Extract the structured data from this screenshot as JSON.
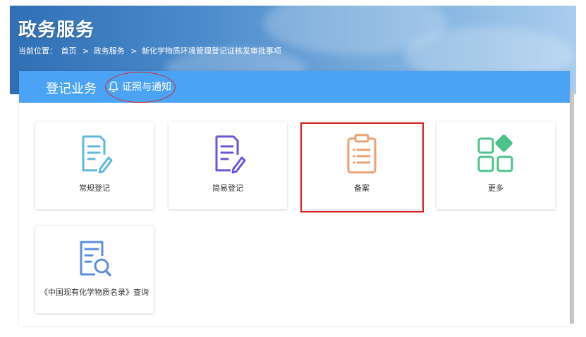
{
  "header": {
    "title": "政务服务",
    "breadcrumb": {
      "prefix": "当前位置：",
      "items": [
        "首页",
        "政务服务",
        "新化学物质环境管理登记证核发审批事项"
      ],
      "separator": ">"
    }
  },
  "tabs": {
    "main": "登记业务",
    "notice": "证照与通知"
  },
  "cards": [
    {
      "label": "常规登记",
      "icon": "document-edit-icon",
      "color": "#5fb8e0"
    },
    {
      "label": "简易登记",
      "icon": "document-edit-icon",
      "color": "#6a55d9"
    },
    {
      "label": "备案",
      "icon": "clipboard-icon",
      "color": "#e9a273"
    },
    {
      "label": "更多",
      "icon": "grid-more-icon",
      "color": "#4cc38a"
    },
    {
      "label": "《中国现有化学物质名录》查询",
      "icon": "document-search-icon",
      "color": "#5b8fe0"
    }
  ],
  "colors": {
    "tab_bar": "#4aa3f5",
    "highlight": "#d41c1c"
  }
}
